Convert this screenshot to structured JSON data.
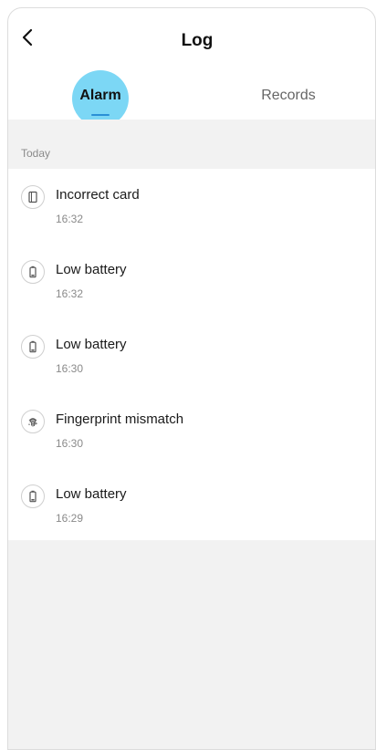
{
  "header": {
    "title": "Log",
    "back_icon": "chevron-left-icon"
  },
  "tabs": [
    {
      "label": "Alarm",
      "active": true
    },
    {
      "label": "Records",
      "active": false
    }
  ],
  "section": {
    "label": "Today"
  },
  "alarms": [
    {
      "title": "Incorrect card",
      "time": "16:32",
      "icon": "card-icon"
    },
    {
      "title": "Low battery",
      "time": "16:32",
      "icon": "battery-icon"
    },
    {
      "title": "Low battery",
      "time": "16:30",
      "icon": "battery-icon"
    },
    {
      "title": "Fingerprint mismatch",
      "time": "16:30",
      "icon": "fingerprint-icon"
    },
    {
      "title": "Low battery",
      "time": "16:29",
      "icon": "battery-icon"
    }
  ],
  "colors": {
    "accent": "#7cd7f5",
    "tab_indicator": "#2a8fd6",
    "section_background": "#f2f2f2"
  }
}
